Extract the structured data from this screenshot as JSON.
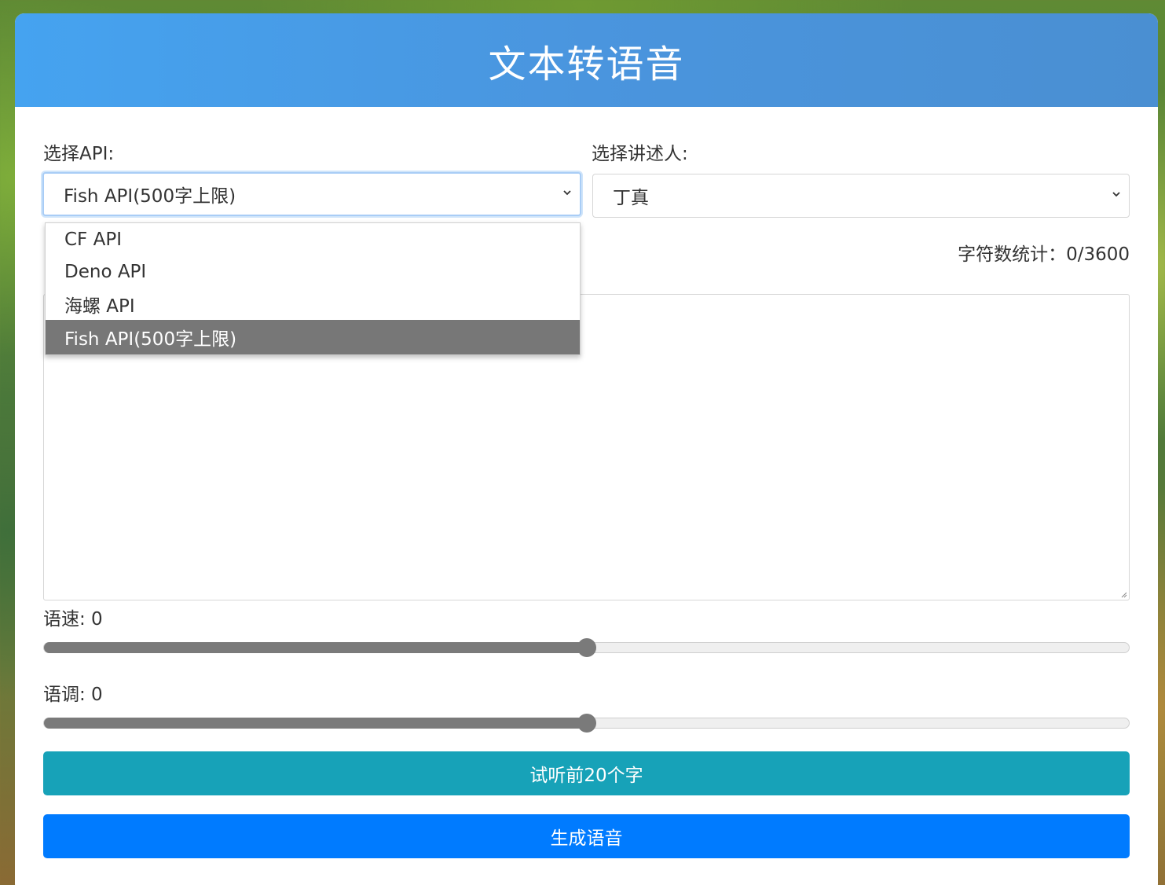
{
  "header": {
    "title": "文本转语音"
  },
  "api": {
    "label": "选择API:",
    "selected": "Fish API(500字上限)",
    "options": [
      "CF API",
      "Deno API",
      "海螺 API",
      "Fish API(500字上限)"
    ],
    "highlighted_index": 3
  },
  "narrator": {
    "label": "选择讲述人:",
    "selected": "丁真"
  },
  "counter": {
    "text": "字符数统计：0/3600"
  },
  "textarea": {
    "value": ""
  },
  "speed": {
    "label": "语速: 0",
    "value": 0,
    "min": -100,
    "max": 100
  },
  "pitch": {
    "label": "语调: 0",
    "value": 0,
    "min": -100,
    "max": 100
  },
  "buttons": {
    "preview": "试听前20个字",
    "generate": "生成语音"
  },
  "colors": {
    "header": "#45a3f0",
    "preview_button": "#17a2b8",
    "generate_button": "#007bff",
    "dropdown_highlight": "#777777"
  }
}
